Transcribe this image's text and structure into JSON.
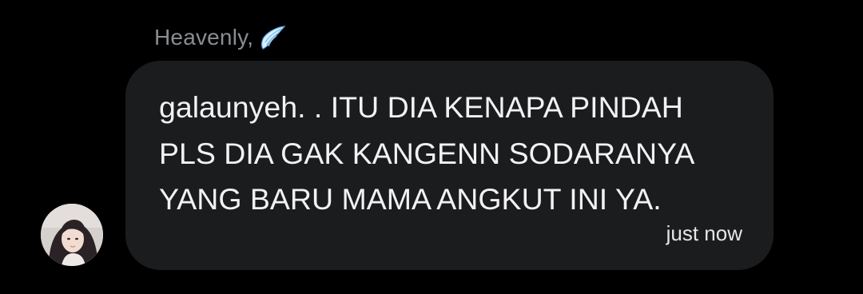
{
  "conversation": {
    "sender": {
      "name": "Heavenly,",
      "name_icon": "angel-wing-icon",
      "avatar": "profile-photo"
    },
    "message": {
      "lines": [
        "galaunyeh. . ITU DIA KENAPA PINDAH",
        "PLS DIA GAK KANGENN SODARANYA",
        "YANG BARU MAMA ANGKUT INI YA."
      ],
      "timestamp": "just now"
    }
  },
  "colors": {
    "background": "#000000",
    "bubble": "#1b1c1e",
    "message_text": "#f2f2f2",
    "sender_text": "#8a8d91",
    "wing_icon": "#8fc6f0"
  }
}
